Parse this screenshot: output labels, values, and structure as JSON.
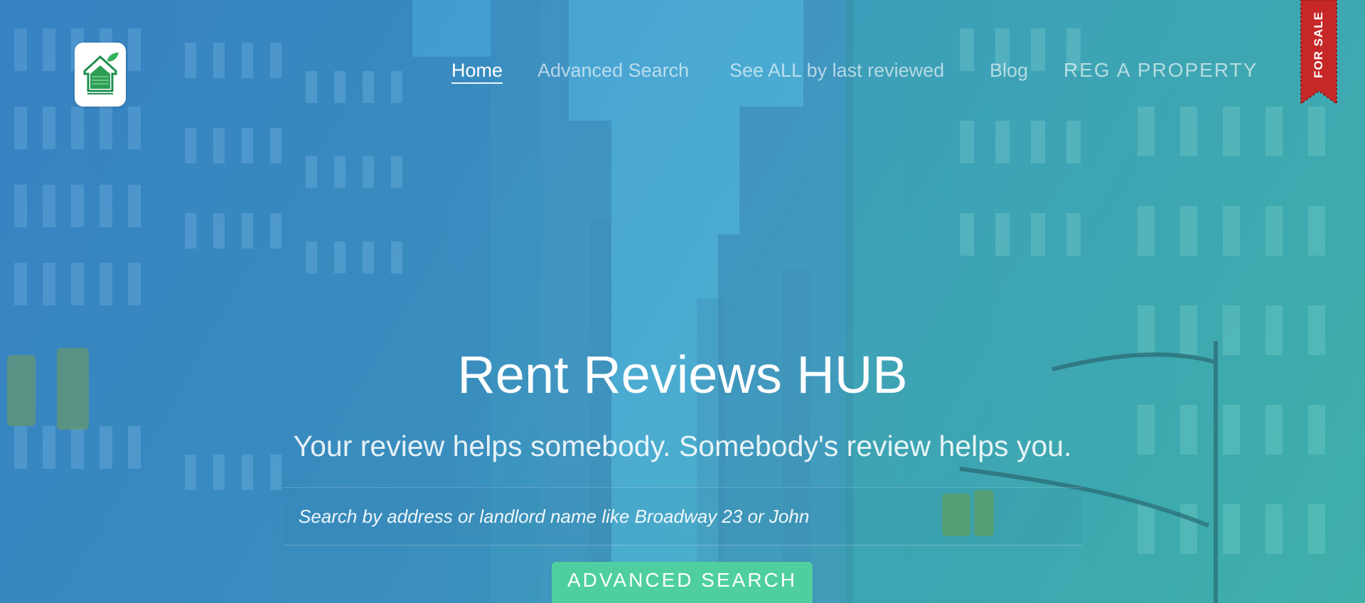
{
  "nav": {
    "items": [
      {
        "label": "Home",
        "active": true
      },
      {
        "label": "Advanced Search",
        "active": false
      },
      {
        "label": "See ALL by last reviewed",
        "active": false
      },
      {
        "label": "Blog",
        "active": false
      },
      {
        "label": "REG A PROPERTY",
        "active": false
      }
    ]
  },
  "logo": {
    "icon": "house-leaf-icon"
  },
  "ribbon": {
    "label": "FOR SALE",
    "color": "#c62828"
  },
  "hero": {
    "title": "Rent Reviews HUB",
    "subtitle": "Your review helps somebody. Somebody's review helps you."
  },
  "search": {
    "placeholder": "Search by address or landlord name like Broadway 23 or John",
    "value": ""
  },
  "advanced_button": {
    "label": "ADVANCED SEARCH",
    "color": "#4fcf9f"
  },
  "colors": {
    "gradient_start": "#3f8fd2",
    "gradient_end": "#46c0b5",
    "text": "#ffffff"
  }
}
